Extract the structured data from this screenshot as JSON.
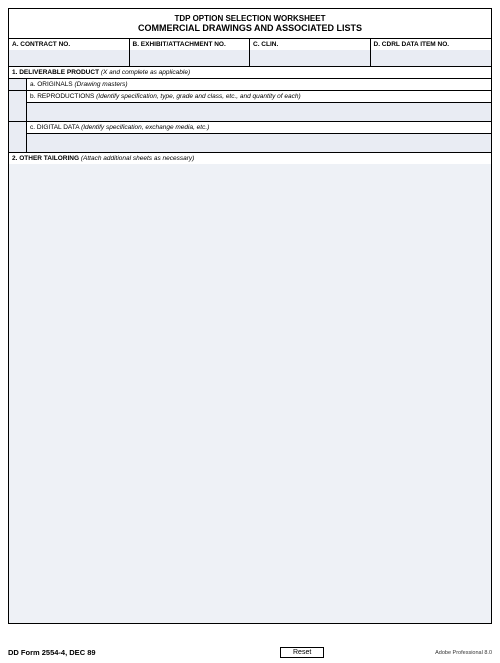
{
  "header": {
    "line1": "TDP OPTION SELECTION WORKSHEET",
    "line2": "COMMERCIAL DRAWINGS AND ASSOCIATED LISTS"
  },
  "fields": {
    "a": "A.  CONTRACT NO.",
    "b": "B.  EXHIBIT/ATTACHMENT NO.",
    "c": "C.  CLIN.",
    "d": "D.  CDRL DATA ITEM NO."
  },
  "section1": {
    "title": "1.  DELIVERABLE PRODUCT",
    "hint": "(X and complete as applicable)",
    "a_label": "a.  ORIGINALS",
    "a_hint": "(Drawing masters)",
    "b_label": "b.  REPRODUCTIONS",
    "b_hint": "(Identify specification, type, grade and class, etc., and quantity of each)",
    "c_label": "c.  DIGITAL DATA",
    "c_hint": "(Identify specification, exchange media, etc.)"
  },
  "section2": {
    "title": "2.  OTHER TAILORING",
    "hint": "(Attach additional sheets as necessary)"
  },
  "footer": {
    "form_id": "DD Form 2554-4, DEC 89",
    "reset": "Reset",
    "adobe": "Adobe Professional 8.0"
  }
}
